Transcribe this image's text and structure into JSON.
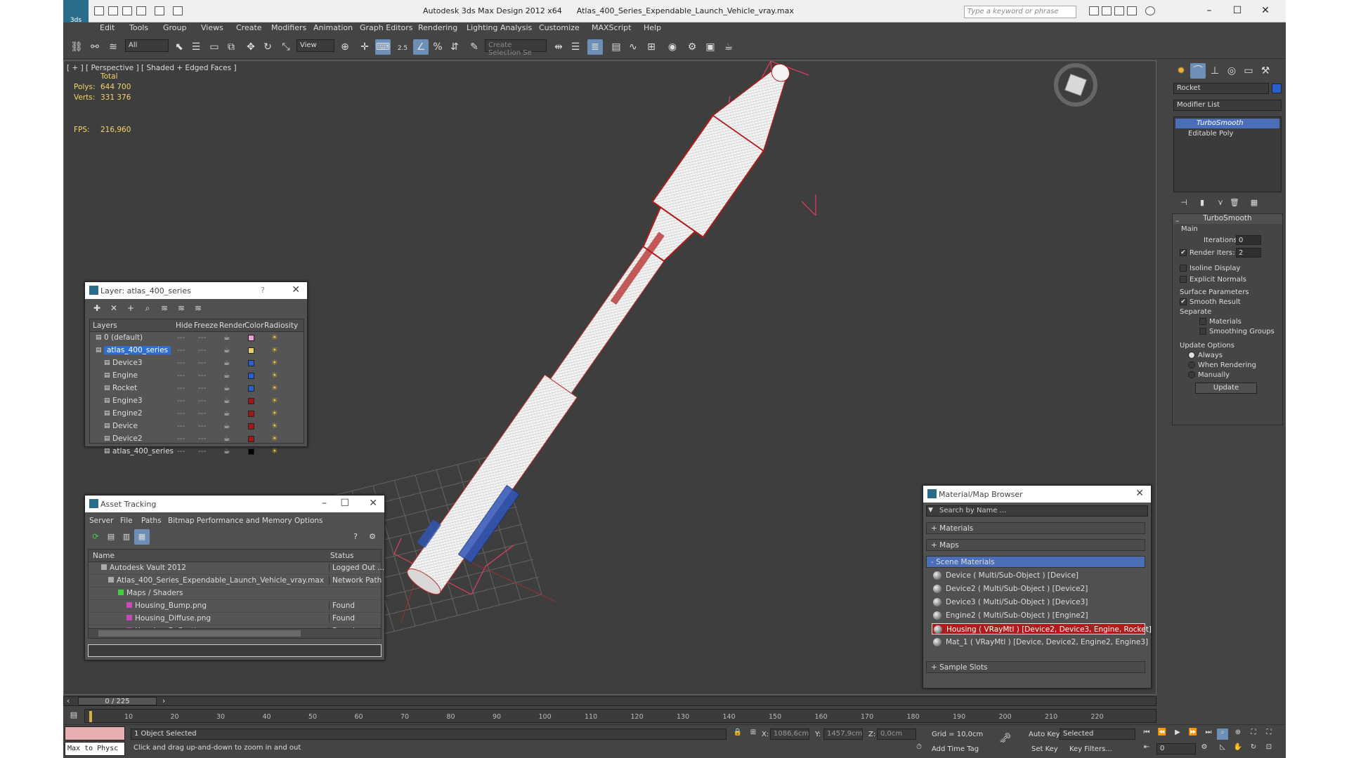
{
  "window": {
    "title": "Autodesk 3ds Max Design 2012 x64      Atlas_400_Series_Expendable_Launch_Vehicle_vray.max",
    "search_placeholder": "Type a keyword or phrase"
  },
  "menu": [
    "Edit",
    "Tools",
    "Group",
    "Views",
    "Create",
    "Modifiers",
    "Animation",
    "Graph Editors",
    "Rendering",
    "Lighting Analysis",
    "Customize",
    "MAXScript",
    "Help"
  ],
  "toolbar": {
    "filter": "All",
    "refcoord": "View",
    "snap_value": "2.5",
    "named_sel": "Create Selection Se"
  },
  "viewport": {
    "label": "[ + ] [ Perspective ] [ Shaded + Edged Faces ]",
    "stats": {
      "header": "Total",
      "polys_label": "Polys:",
      "polys": "644 700",
      "verts_label": "Verts:",
      "verts": "331 376",
      "fps_label": "FPS:",
      "fps": "216,960"
    }
  },
  "layer_panel": {
    "title": "Layer: atlas_400_series",
    "columns": [
      "Layers",
      "Hide",
      "Freeze",
      "Render",
      "Color",
      "Radiosity"
    ],
    "rows": [
      {
        "name": "0 (default)",
        "color": "#e8a0d8"
      },
      {
        "name": "atlas_400_series",
        "color": "#e8d070"
      },
      {
        "name": "Device3",
        "color": "#2860d0"
      },
      {
        "name": "Engine",
        "color": "#2860d0"
      },
      {
        "name": "Rocket",
        "color": "#2860d0"
      },
      {
        "name": "Engine3",
        "color": "#a01818"
      },
      {
        "name": "Engine2",
        "color": "#a01818"
      },
      {
        "name": "Device",
        "color": "#a01818"
      },
      {
        "name": "Device2",
        "color": "#a01818"
      },
      {
        "name": "atlas_400_series",
        "color": "#000000"
      }
    ]
  },
  "asset_panel": {
    "title": "Asset Tracking",
    "menu": [
      "Server",
      "File",
      "Paths",
      "Bitmap Performance and Memory",
      "Options"
    ],
    "columns": [
      "Name",
      "Status"
    ],
    "rows": [
      {
        "name": "Autodesk Vault 2012",
        "status": "Logged Out ..."
      },
      {
        "name": "Atlas_400_Series_Expendable_Launch_Vehicle_vray.max",
        "status": "Network Path"
      },
      {
        "name": "Maps / Shaders",
        "status": ""
      },
      {
        "name": "Housing_Bump.png",
        "status": "Found"
      },
      {
        "name": "Housing_Diffuse.png",
        "status": "Found"
      },
      {
        "name": "Housing_Reflection.png",
        "status": "Found"
      }
    ]
  },
  "material_panel": {
    "title": "Material/Map Browser",
    "search_placeholder": "Search by Name ...",
    "sections": {
      "materials": "+ Materials",
      "maps": "+ Maps",
      "scene": "- Scene Materials",
      "sample": "+ Sample Slots"
    },
    "items": [
      "Device  ( Multi/Sub-Object )  [Device]",
      "Device2  ( Multi/Sub-Object )  [Device2]",
      "Device3  ( Multi/Sub-Object )  [Device3]",
      "Engine2  ( Multi/Sub-Object )  [Engine2]",
      "Housing  ( VRayMtl )  [Device2, Device3, Engine, Rocket]",
      "Mat_1  ( VRayMtl )  [Device, Device2, Engine2, Engine3]"
    ]
  },
  "command_panel": {
    "object_name": "Rocket",
    "modifier_list": "Modifier List",
    "stack": [
      "TurboSmooth",
      "Editable Poly"
    ],
    "turbosmooth": {
      "title": "TurboSmooth",
      "main": "Main",
      "iterations_label": "Iterations:",
      "iterations": "0",
      "render_iters_label": "Render Iters:",
      "render_iters": "2",
      "isoline": "Isoline Display",
      "explicit": "Explicit Normals",
      "surface": "Surface Parameters",
      "smooth_result": "Smooth Result",
      "separate": "Separate",
      "materials": "Materials",
      "smoothing": "Smoothing Groups",
      "update_options": "Update Options",
      "always": "Always",
      "when_rendering": "When Rendering",
      "manually": "Manually",
      "update": "Update"
    }
  },
  "timeline": {
    "frame": "0 / 225",
    "ticks": [
      "10",
      "20",
      "30",
      "40",
      "50",
      "60",
      "70",
      "80",
      "90",
      "100",
      "110",
      "120",
      "130",
      "140",
      "150",
      "160",
      "170",
      "180",
      "190",
      "200",
      "210",
      "220"
    ]
  },
  "status": {
    "maxscript": "Max to Physc",
    "selected": "1 Object Selected",
    "prompt": "Click and drag up-and-down to zoom in and out",
    "x_label": "X:",
    "x": "1086,6cm",
    "y_label": "Y:",
    "y": "1457,9cm",
    "z_label": "Z:",
    "z": "0,0cm",
    "grid": "Grid = 10,0cm",
    "add_time_tag": "Add Time Tag",
    "auto_key": "Auto Key",
    "set_key": "Set Key",
    "key_mode": "Selected",
    "key_filters": "Key Filters...",
    "frame_field": "0"
  }
}
